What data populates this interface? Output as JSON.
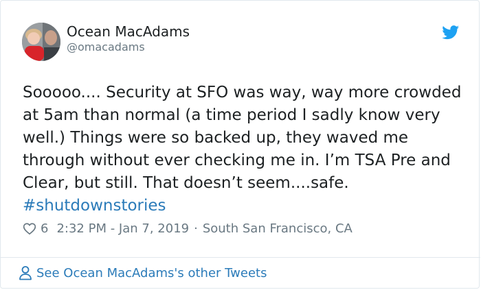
{
  "author": {
    "name": "Ocean MacAdams",
    "handle": "@omacadams"
  },
  "icons": {
    "brand": "twitter-bird-icon",
    "like": "heart-icon",
    "profile": "person-icon"
  },
  "colors": {
    "accent": "#1da1f2",
    "link": "#2b7bb9",
    "text": "#1c2022",
    "muted": "#697882",
    "border": "#e1e8ed"
  },
  "tweet": {
    "text": "Sooooo.... Security at SFO was way, way more crowded at 5am than normal (a time period I sadly know very well.) Things were so backed up, they waved me through without ever checking me in. I’m TSA Pre and Clear, but still. That doesn’t seem....safe.",
    "hashtag": "#shutdownstories",
    "likes": "6",
    "timestamp": "2:32 PM - Jan 7, 2019",
    "separator": "·",
    "location": "South San Francisco, CA"
  },
  "footer": {
    "more_tweets_label": "See Ocean MacAdams's other Tweets"
  }
}
